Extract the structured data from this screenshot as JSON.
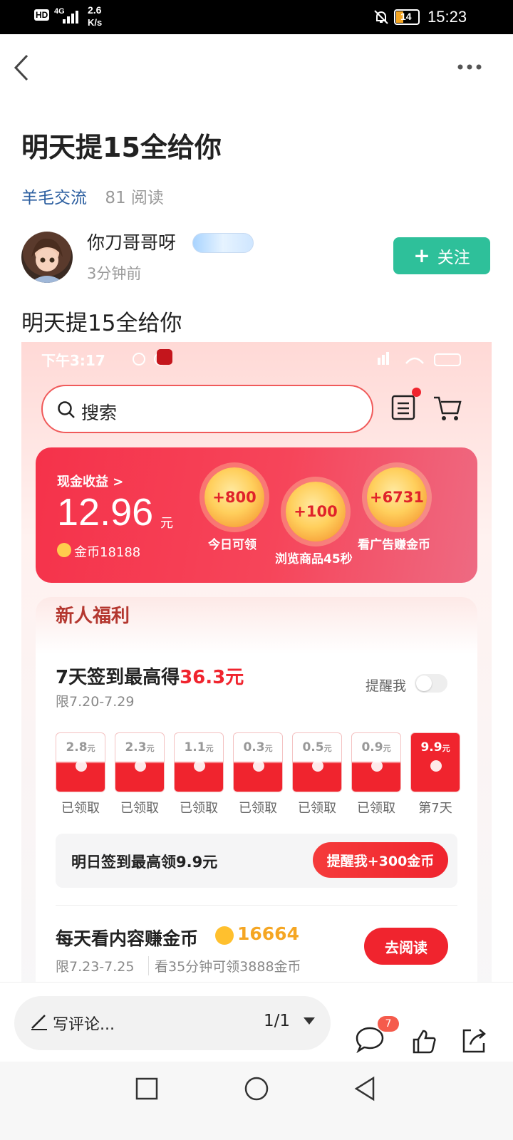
{
  "status_bar": {
    "network": "4G",
    "speed_top": "2.6",
    "speed_bottom": "K/s",
    "battery": "14",
    "time": "15:23"
  },
  "post": {
    "title": "明天提15全给你",
    "category": "羊毛交流",
    "reads": "81 阅读",
    "author_name": "你刀哥哥呀",
    "time_ago": "3分钟前",
    "follow_label": "关注",
    "body": "明天提15全给你"
  },
  "screenshot": {
    "status_time": "下午3:17",
    "search_placeholder": "搜索",
    "cash_label": "现金收益 >",
    "cash_amount": "12.96",
    "cash_unit": "元",
    "coins_label": "金币18188",
    "rewards": [
      {
        "value": "+800",
        "label": "今日可领"
      },
      {
        "value": "+100",
        "label": "浏览商品45秒"
      },
      {
        "value": "+6731",
        "label": "看广告赚金币"
      }
    ],
    "welfare_title": "新人福利",
    "signin_title_prefix": "7天签到最高得",
    "signin_title_amount": "36.3元",
    "signin_period": "限7.20-7.29",
    "remind_label": "提醒我",
    "envelopes": [
      {
        "value": "2.8",
        "unit": "元",
        "label": "已领取"
      },
      {
        "value": "2.3",
        "unit": "元",
        "label": "已领取"
      },
      {
        "value": "1.1",
        "unit": "元",
        "label": "已领取"
      },
      {
        "value": "0.3",
        "unit": "元",
        "label": "已领取"
      },
      {
        "value": "0.5",
        "unit": "元",
        "label": "已领取"
      },
      {
        "value": "0.9",
        "unit": "元",
        "label": "已领取"
      },
      {
        "value": "9.9",
        "unit": "元",
        "label": "第7天"
      }
    ],
    "tomorrow_text": "明日签到最高领9.9元",
    "tomorrow_button": "提醒我+300金币",
    "read_title": "每天看内容赚金币",
    "read_coins": "16664",
    "read_period": "限7.23-7.25",
    "read_desc": "看35分钟可领3888金币",
    "read_button": "去阅读"
  },
  "bottom_bar": {
    "comment_placeholder": "写评论...",
    "page_indicator": "1/1",
    "comment_badge": "7"
  },
  "colors": {
    "accent_green": "#2ec09a",
    "category_blue": "#2a5d9f",
    "red": "#f0242e"
  }
}
